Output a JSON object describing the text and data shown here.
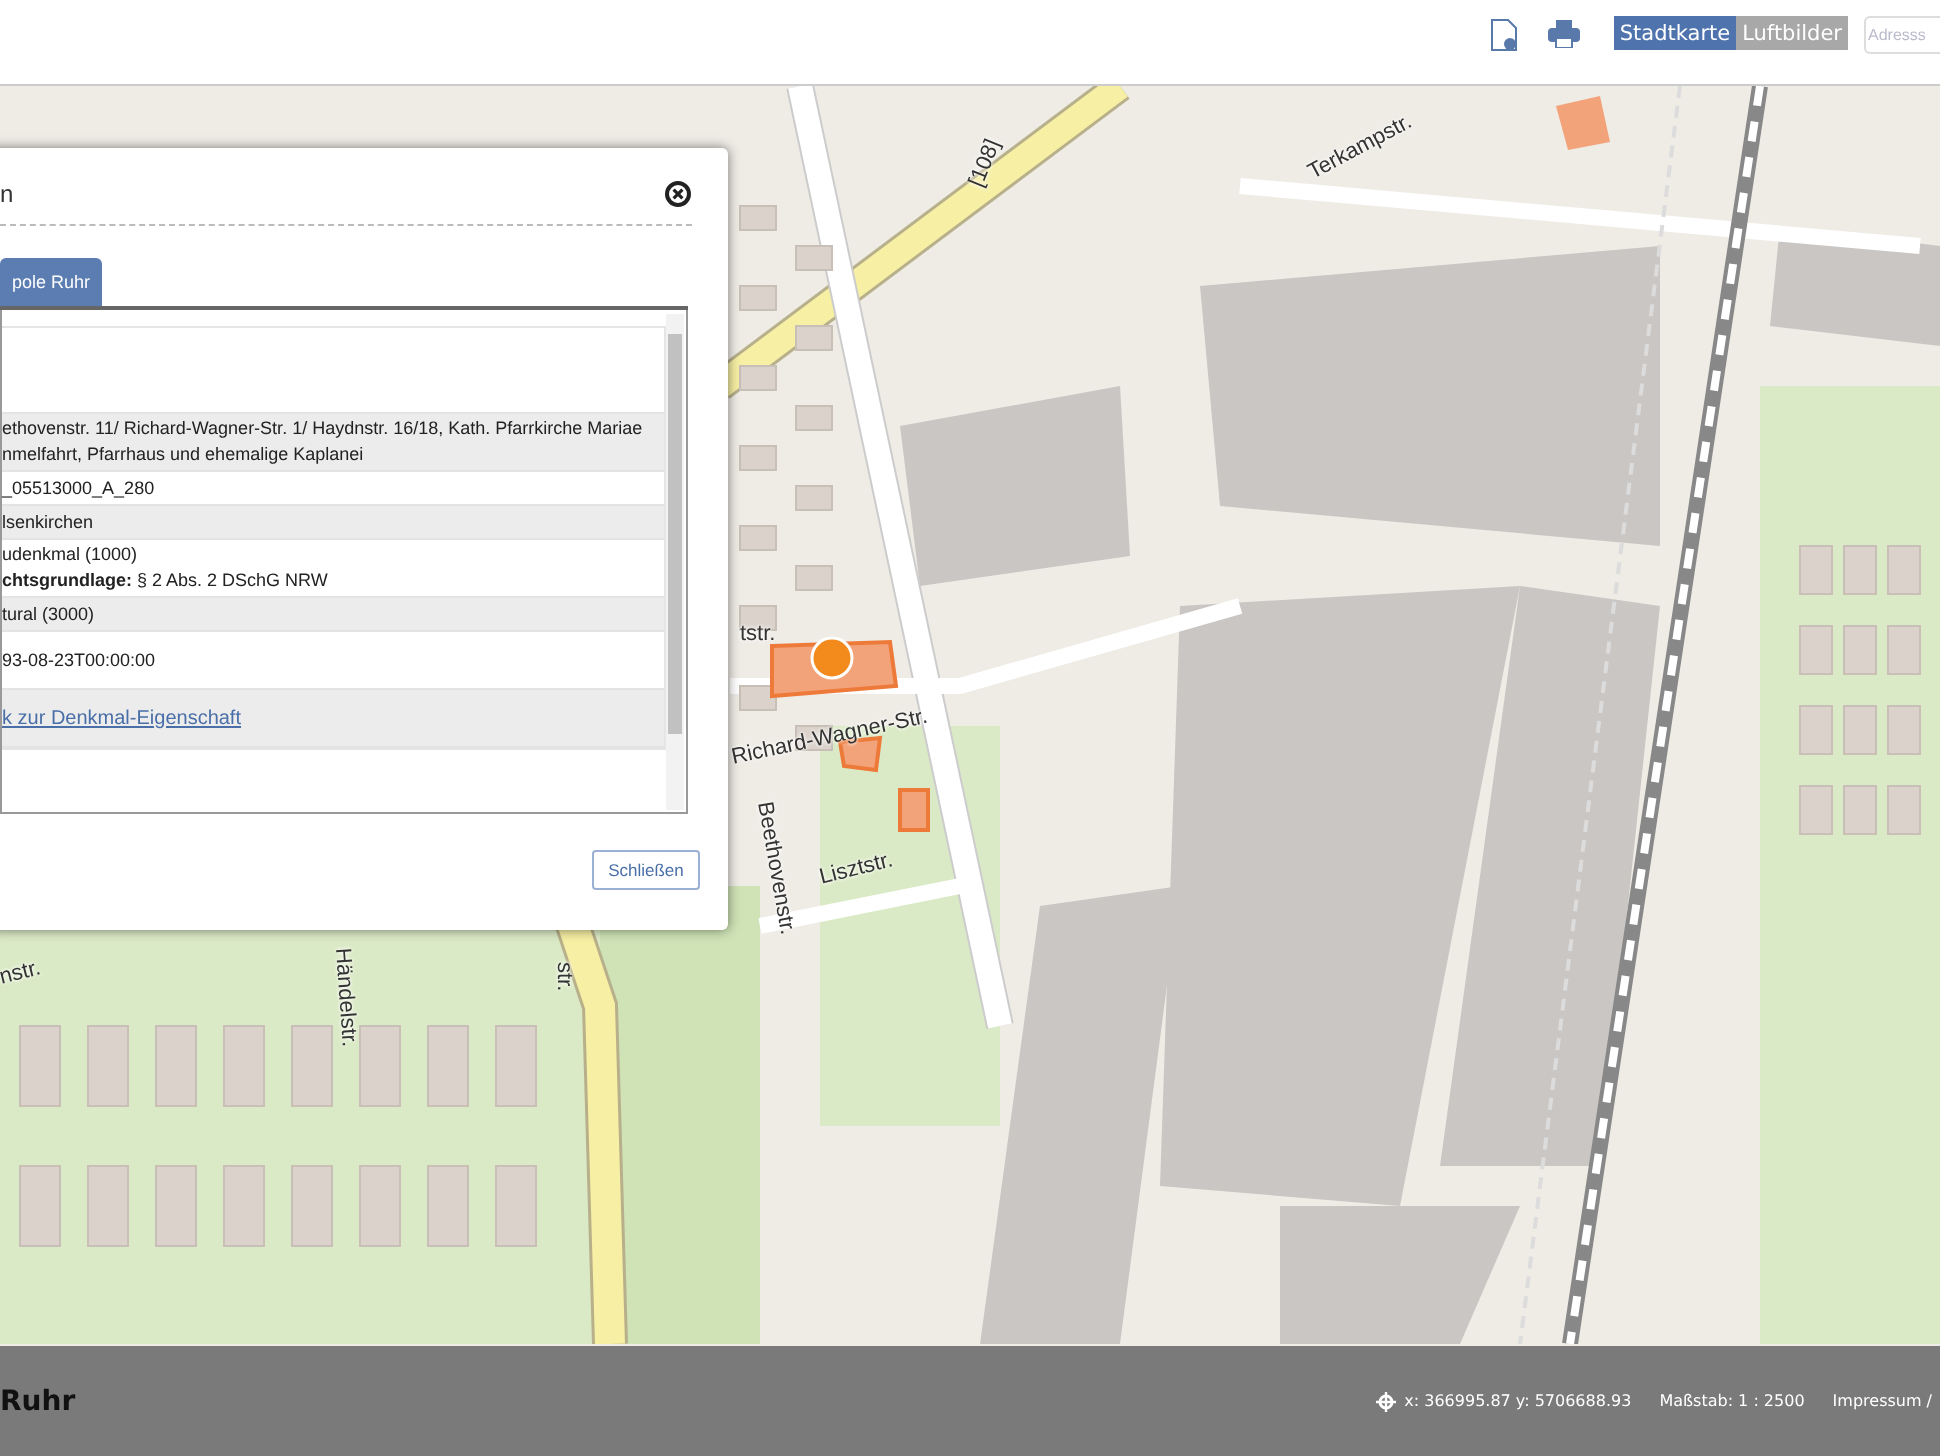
{
  "header": {
    "map_types": [
      {
        "label": "Stadtkarte",
        "selected": true
      },
      {
        "label": "Luftbilder",
        "selected": false
      }
    ],
    "search": {
      "placeholder": "Adresss"
    }
  },
  "map": {
    "street_labels": [
      "Terkampstr.",
      "[108]",
      "tstr.",
      "Richard-Wagner-Str.",
      "Beethovenstr.",
      "Lisztstr.",
      "Händelstr.",
      "nstr.",
      "str."
    ]
  },
  "dialog": {
    "title": "n",
    "tabs": [
      {
        "label": "pole Ruhr",
        "selected": true
      }
    ],
    "rows": [
      {
        "kind": "blank"
      },
      {
        "kind": "text",
        "lines": [
          "ethovenstr. 11/ Richard-Wagner-Str. 1/ Haydnstr. 16/18, Kath. Pfarrkirche Mariae",
          "nmelfahrt, Pfarrhaus und ehemalige Kaplanei"
        ]
      },
      {
        "kind": "text",
        "lines": [
          "_05513000_A_280"
        ]
      },
      {
        "kind": "text",
        "lines": [
          "lsenkirchen"
        ]
      },
      {
        "kind": "text",
        "lines": [
          "udenkmal (1000)",
          "**chtsgrundlage:** § 2 Abs. 2 DSchG NRW"
        ]
      },
      {
        "kind": "text",
        "lines": [
          "tural (3000)"
        ]
      },
      {
        "kind": "tall",
        "lines": [
          "93-08-23T00:00:00"
        ]
      },
      {
        "kind": "link",
        "lines": [
          "k zur Denkmal-Eigenschaft"
        ]
      }
    ],
    "close_button": "Schließen"
  },
  "footer": {
    "title": "Ruhr",
    "coordinates": "x: 366995.87 y: 5706688.93",
    "scale": "Maßstab: 1 : 2500",
    "links": "Impressum /"
  }
}
